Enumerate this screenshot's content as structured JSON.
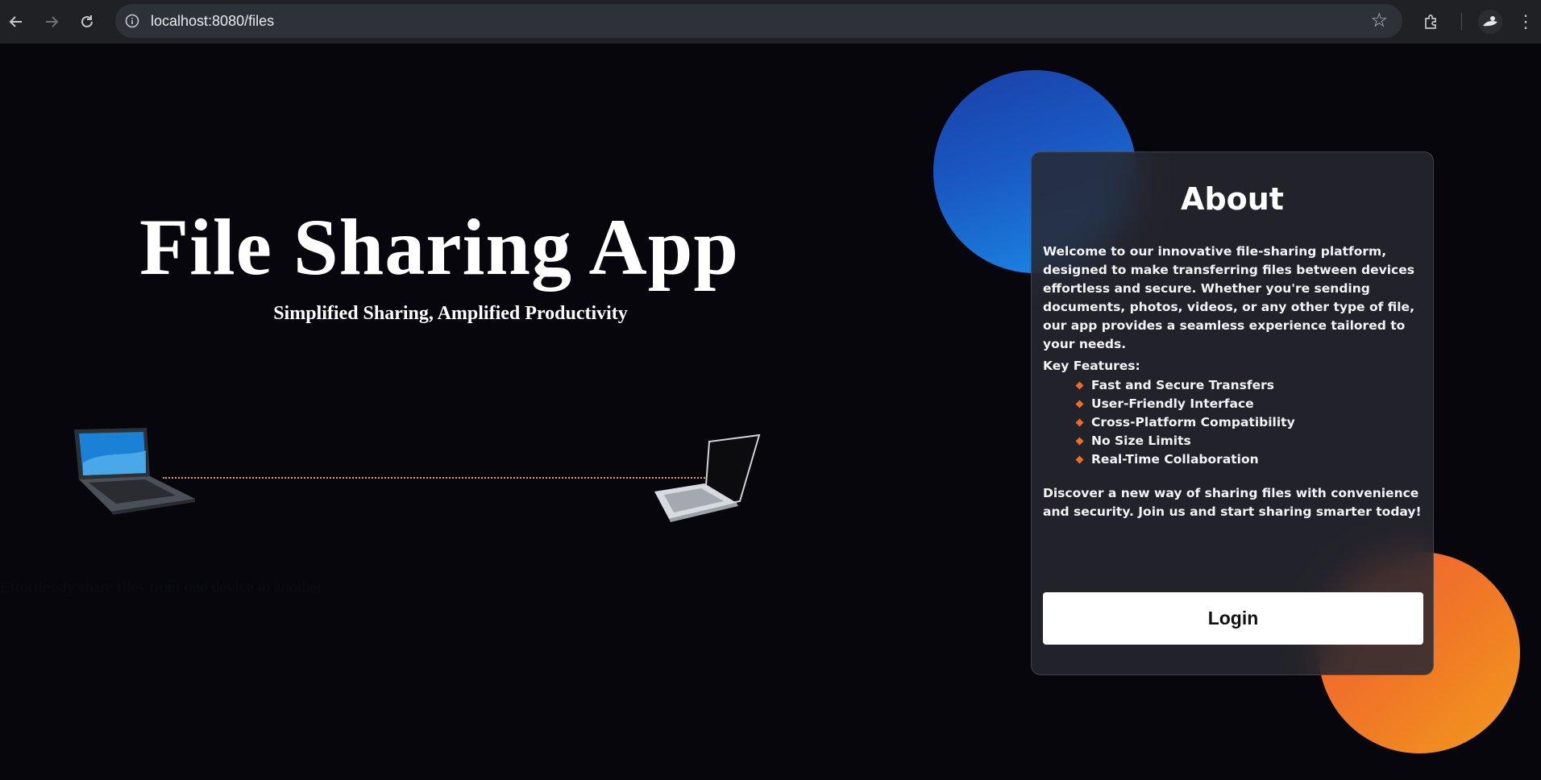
{
  "browser": {
    "url": "localhost:8080/files",
    "icons": {
      "back": "back-arrow-icon",
      "forward": "forward-arrow-icon",
      "reload": "reload-icon",
      "info": "info-icon",
      "bookmark": "star-icon",
      "extensions": "puzzle-icon",
      "profile": "avatar",
      "menu": "kebab-menu-icon"
    }
  },
  "hero": {
    "title": "File Sharing App",
    "subtitle": "Simplified Sharing, Amplified Productivity",
    "tagline": "Effortlessly share files from one device to another"
  },
  "about": {
    "title": "About",
    "intro": "Welcome to our innovative file-sharing platform, designed to make transferring files between devices effortless and secure. Whether you're sending documents, photos, videos, or any other type of file, our app provides a seamless experience tailored to your needs.",
    "features_title": "Key Features:",
    "features": [
      "Fast and Secure Transfers",
      "User-Friendly Interface",
      "Cross-Platform Compatibility",
      "No Size Limits",
      "Real-Time Collaboration"
    ],
    "outro": "Discover a new way of sharing files with convenience and security. Join us and start sharing smarter today!",
    "login_label": "Login"
  },
  "colors": {
    "background": "#06060c",
    "accent_blue": "#1a59c4",
    "accent_orange": "#f07a25",
    "dotted_line": "#e6a33a",
    "bullet": "#f26a25"
  }
}
